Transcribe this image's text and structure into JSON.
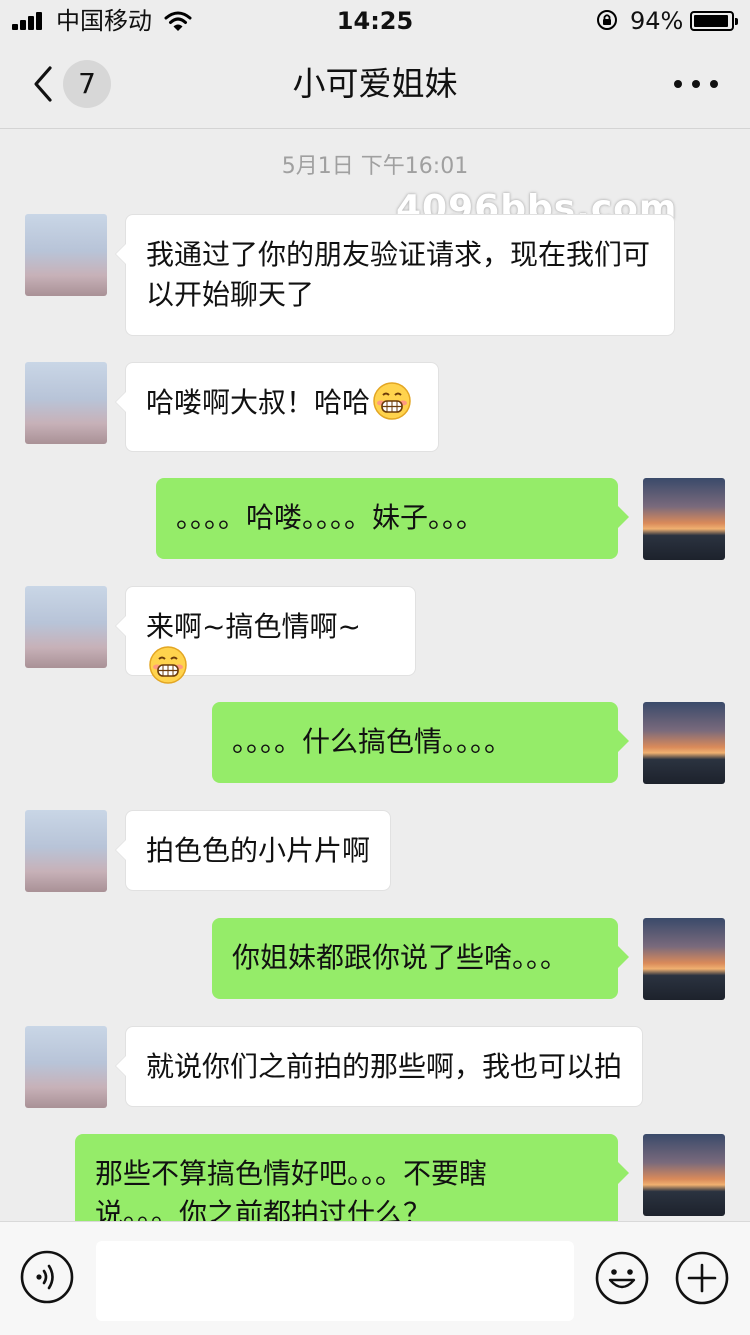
{
  "status_bar": {
    "carrier": "中国移动",
    "time": "14:25",
    "battery_percent": "94%",
    "battery_level": 0.94,
    "icons": [
      "signal-icon",
      "wifi-icon",
      "orientation-lock-icon",
      "battery-icon"
    ]
  },
  "nav": {
    "back_icon": "chevron-left-icon",
    "unread_count": "7",
    "title": "小可爱姐妹",
    "more_icon": "more-dots-icon"
  },
  "chat": {
    "timestamp": "5月1日 下午16:01",
    "watermark": "4096bbs.com",
    "messages": [
      {
        "sender": "her",
        "text_lines": [
          "我通过了你的朋友验证请求，现在我们可",
          "以开始聊天了"
        ]
      },
      {
        "sender": "her",
        "text": "哈喽啊大叔！哈哈",
        "emoji": "grinning-face-icon"
      },
      {
        "sender": "me",
        "text": "。。。。哈喽。。。。妹子。。。"
      },
      {
        "sender": "her",
        "text": "来啊~搞色情啊~",
        "emoji": "grinning-face-icon"
      },
      {
        "sender": "me",
        "text": "。。。。什么搞色情。。。。"
      },
      {
        "sender": "her",
        "text": "拍色色的小片片啊"
      },
      {
        "sender": "me",
        "text": "你姐妹都跟你说了些啥。。。"
      },
      {
        "sender": "her",
        "text": "就说你们之前拍的那些啊，我也可以拍"
      },
      {
        "sender": "me",
        "text_lines": [
          "那些不算搞色情好吧。。。不要瞎",
          "说。。。你之前都拍过什么？"
        ]
      }
    ]
  },
  "input_bar": {
    "voice_icon": "voice-input-icon",
    "emoji_icon": "emoji-face-icon",
    "plus_icon": "plus-circle-icon",
    "field_value": ""
  },
  "colors": {
    "background": "#ededed",
    "sent_bubble": "#95ec69",
    "received_bubble": "#ffffff",
    "timestamp_text": "#a0a0a0"
  }
}
